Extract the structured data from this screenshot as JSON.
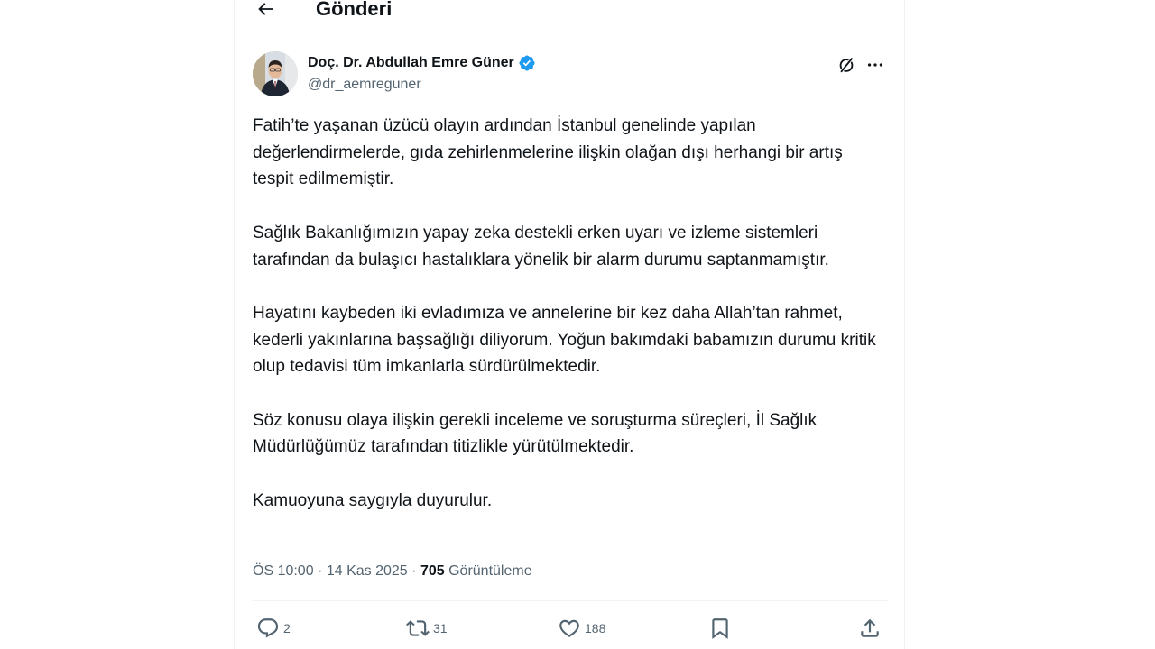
{
  "header": {
    "back_icon": "arrow-left-icon",
    "title": "Gönderi"
  },
  "author": {
    "name": "Doç. Dr. Abdullah Emre Güner",
    "handle": "@dr_aemreguner",
    "verified": true,
    "verified_color": "#1d9bf0"
  },
  "tweet": {
    "paragraphs": [
      "Fatih’te yaşanan üzücü olayın ardından İstanbul genelinde yapılan değerlendirmelerde, gıda zehirlenmelerine ilişkin olağan dışı herhangi bir artış tespit edilmemiştir.",
      "Sağlık Bakanlığımızın yapay zeka destekli erken uyarı ve izleme sistemleri tarafından da bulaşıcı hastalıklara yönelik bir alarm durumu saptanmamıştır.",
      "Hayatını kaybeden iki evladımıza ve annelerine bir kez daha Allah’tan rahmet, kederli yakınlarına başsağlığı diliyorum. Yoğun bakımdaki babamızın durumu kritik olup tedavisi tüm imkanlarla sürdürülmektedir.",
      "Söz konusu olaya ilişkin gerekli inceleme ve soruşturma süreçleri, İl Sağlık Müdürlüğümüz tarafından titizlikle yürütülmektedir.",
      "Kamuoyuna saygıyla duyurulur."
    ],
    "time": "ÖS 10:00",
    "separator": "·",
    "date": "14 Kas 2025",
    "views_count": "705",
    "views_label": "Görüntüleme"
  },
  "actions": {
    "replies": "2",
    "reposts": "31",
    "likes": "188"
  },
  "colors": {
    "text": "#0f1419",
    "secondary": "#536471",
    "border": "#eff3f4",
    "accent": "#1d9bf0"
  }
}
